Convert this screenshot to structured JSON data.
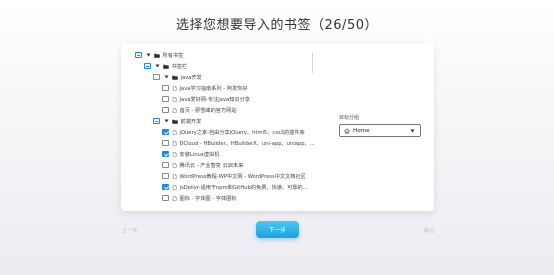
{
  "title": "选择您想要导入的书签（26/50）",
  "tree": [
    {
      "label": "所有书签",
      "level": 0,
      "check": "partial",
      "caret": true,
      "icon": "folder-icon"
    },
    {
      "label": "书签栏",
      "level": 1,
      "check": "partial",
      "caret": true,
      "icon": "folder-icon"
    },
    {
      "label": "java开发",
      "level": 2,
      "check": "unchecked",
      "caret": true,
      "icon": "folder-icon"
    },
    {
      "label": "Java学习指南系列 - 阿发你好",
      "level": 3,
      "check": "unchecked",
      "caret": false,
      "icon": "page-icon"
    },
    {
      "label": "Java爱好网-专注Java知识分享",
      "level": 3,
      "check": "unchecked",
      "caret": false,
      "icon": "page-icon"
    },
    {
      "label": "首页 - 廖雪峰的官方网站",
      "level": 3,
      "check": "unchecked",
      "caret": false,
      "icon": "page-icon"
    },
    {
      "label": "前端开发",
      "level": 2,
      "check": "partial",
      "caret": true,
      "icon": "folder-icon"
    },
    {
      "label": "jQuery之家-自由分享jQuery、html5、css3的插件库",
      "level": 3,
      "check": "checked",
      "caret": false,
      "icon": "page-icon"
    },
    {
      "label": "DCloud - HBuilder、HBuilderX、uni-app、uniapp、...",
      "level": 3,
      "check": "unchecked",
      "caret": false,
      "icon": "page-icon"
    },
    {
      "label": "安装Linux虚拟机",
      "level": 3,
      "check": "checked",
      "caret": false,
      "icon": "page-icon"
    },
    {
      "label": "腾讯云 - 产业智变 云启未来",
      "level": 3,
      "check": "unchecked",
      "caret": false,
      "icon": "page-icon"
    },
    {
      "label": "WordPress教程-WP中文网 - WordPress中文文档社区",
      "level": 3,
      "check": "unchecked",
      "caret": false,
      "icon": "page-icon"
    },
    {
      "label": "jsDelivr-适用于npm和GitHub的免费、快速、可靠的...",
      "level": 3,
      "check": "checked",
      "caret": false,
      "icon": "page-icon"
    },
    {
      "label": "图标 - 字体图 - 字体图标",
      "level": 3,
      "check": "unchecked",
      "caret": false,
      "icon": "page-icon"
    }
  ],
  "target": {
    "label": "目标分组",
    "value": "Home"
  },
  "buttons": {
    "prev": "上一步",
    "next": "下一步",
    "skip": "跳过"
  },
  "colors": {
    "accent": "#1e88e5",
    "next_button": "#1aa3df"
  }
}
